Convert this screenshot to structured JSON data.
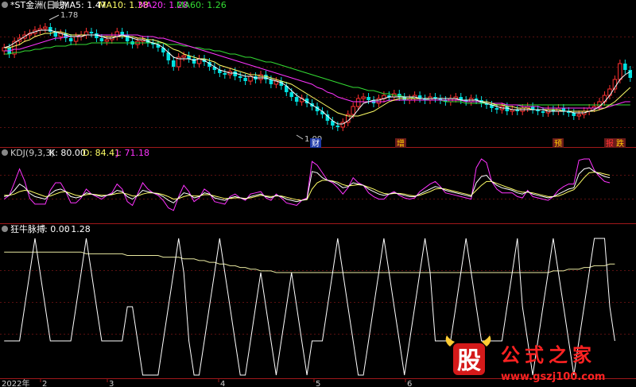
{
  "top_panel": {
    "title": "*ST金洲(日线)",
    "indicators": [
      {
        "label": "MA5: 1.47",
        "color": "#ffffff"
      },
      {
        "label": "MA10: 1.38",
        "color": "#ffff66"
      },
      {
        "label": "MA20: 1.28",
        "color": "#ff33ff"
      },
      {
        "label": "MA60: 1.26",
        "color": "#33dd33"
      }
    ],
    "high_label": "1.78",
    "low_label": "1.09",
    "markers": [
      {
        "text": "财",
        "color": "#3a6bff"
      },
      {
        "text": "增",
        "color": "#ffcc00"
      },
      {
        "text": "预",
        "color": "#ffcc00"
      },
      {
        "text": "报",
        "color": "#ff3333"
      },
      {
        "text": "跌",
        "color": "#ffcc00"
      }
    ]
  },
  "kdj_panel": {
    "title": "KDJ(9,3,3)",
    "values": [
      {
        "label": "K: 80.00",
        "color": "#ffffff"
      },
      {
        "label": "D: 84.41",
        "color": "#ffff66"
      },
      {
        "label": "J: 71.18",
        "color": "#ff33ff"
      }
    ]
  },
  "bottom_panel": {
    "title": "狂牛脉搏",
    "values": [
      {
        "label": ": 0.00",
        "color": "#ffffff"
      },
      {
        "label": ": 1.28",
        "color": "#ffffff"
      }
    ]
  },
  "x_axis": {
    "labels": [
      "2022年",
      "2",
      "3",
      "4",
      "5",
      "6"
    ]
  },
  "watermark": {
    "logo_char": "股",
    "name": "公式之家",
    "url": "www.gszj100.com"
  },
  "chart_data": {
    "type": "candlestick",
    "price": {
      "ylim": [
        1.0,
        1.85
      ],
      "closes": [
        1.62,
        1.58,
        1.66,
        1.68,
        1.7,
        1.71,
        1.73,
        1.74,
        1.75,
        1.72,
        1.69,
        1.71,
        1.68,
        1.66,
        1.69,
        1.7,
        1.72,
        1.71,
        1.68,
        1.66,
        1.67,
        1.69,
        1.72,
        1.7,
        1.66,
        1.64,
        1.66,
        1.67,
        1.65,
        1.64,
        1.62,
        1.59,
        1.54,
        1.5,
        1.56,
        1.57,
        1.55,
        1.52,
        1.55,
        1.53,
        1.5,
        1.48,
        1.46,
        1.45,
        1.47,
        1.44,
        1.43,
        1.41,
        1.44,
        1.42,
        1.45,
        1.42,
        1.39,
        1.41,
        1.38,
        1.34,
        1.31,
        1.28,
        1.3,
        1.27,
        1.25,
        1.22,
        1.2,
        1.16,
        1.13,
        1.12,
        1.15,
        1.2,
        1.25,
        1.3,
        1.31,
        1.29,
        1.27,
        1.3,
        1.32,
        1.31,
        1.33,
        1.31,
        1.29,
        1.3,
        1.32,
        1.3,
        1.29,
        1.31,
        1.3,
        1.29,
        1.28,
        1.3,
        1.31,
        1.29,
        1.28,
        1.3,
        1.29,
        1.27,
        1.26,
        1.24,
        1.23,
        1.25,
        1.22,
        1.23,
        1.22,
        1.24,
        1.25,
        1.23,
        1.22,
        1.21,
        1.23,
        1.22,
        1.24,
        1.22,
        1.21,
        1.19,
        1.2,
        1.22,
        1.24,
        1.25,
        1.28,
        1.32,
        1.36,
        1.42,
        1.52,
        1.48,
        1.43
      ],
      "ma5": [
        1.62,
        1.63,
        1.65,
        1.67,
        1.69,
        1.71,
        1.72,
        1.73,
        1.73,
        1.73,
        1.72,
        1.71,
        1.7,
        1.69,
        1.69,
        1.69,
        1.7,
        1.7,
        1.7,
        1.69,
        1.68,
        1.68,
        1.69,
        1.7,
        1.69,
        1.68,
        1.67,
        1.67,
        1.66,
        1.65,
        1.64,
        1.62,
        1.59,
        1.56,
        1.55,
        1.55,
        1.55,
        1.54,
        1.55,
        1.54,
        1.52,
        1.5,
        1.48,
        1.47,
        1.46,
        1.46,
        1.45,
        1.44,
        1.44,
        1.43,
        1.43,
        1.43,
        1.42,
        1.41,
        1.4,
        1.38,
        1.35,
        1.32,
        1.3,
        1.28,
        1.26,
        1.24,
        1.22,
        1.19,
        1.16,
        1.14,
        1.14,
        1.16,
        1.19,
        1.23,
        1.27,
        1.28,
        1.29,
        1.29,
        1.3,
        1.31,
        1.31,
        1.31,
        1.31,
        1.31,
        1.31,
        1.3,
        1.3,
        1.3,
        1.3,
        1.3,
        1.3,
        1.3,
        1.3,
        1.29,
        1.29,
        1.29,
        1.29,
        1.28,
        1.27,
        1.26,
        1.25,
        1.24,
        1.24,
        1.23,
        1.23,
        1.23,
        1.23,
        1.23,
        1.23,
        1.23,
        1.22,
        1.22,
        1.22,
        1.22,
        1.22,
        1.21,
        1.21,
        1.21,
        1.22,
        1.23,
        1.25,
        1.28,
        1.32,
        1.37,
        1.42,
        1.45,
        1.47
      ],
      "ma10": [
        1.62,
        1.62,
        1.63,
        1.64,
        1.66,
        1.67,
        1.69,
        1.7,
        1.71,
        1.71,
        1.72,
        1.72,
        1.71,
        1.7,
        1.7,
        1.7,
        1.7,
        1.7,
        1.7,
        1.69,
        1.69,
        1.69,
        1.69,
        1.69,
        1.69,
        1.69,
        1.68,
        1.68,
        1.67,
        1.67,
        1.66,
        1.65,
        1.63,
        1.61,
        1.6,
        1.58,
        1.57,
        1.56,
        1.55,
        1.55,
        1.54,
        1.53,
        1.51,
        1.5,
        1.49,
        1.48,
        1.47,
        1.46,
        1.45,
        1.45,
        1.44,
        1.44,
        1.43,
        1.42,
        1.41,
        1.4,
        1.39,
        1.37,
        1.35,
        1.33,
        1.31,
        1.29,
        1.27,
        1.25,
        1.23,
        1.21,
        1.2,
        1.19,
        1.19,
        1.19,
        1.2,
        1.21,
        1.22,
        1.24,
        1.26,
        1.28,
        1.29,
        1.3,
        1.3,
        1.3,
        1.3,
        1.3,
        1.3,
        1.3,
        1.3,
        1.3,
        1.3,
        1.3,
        1.3,
        1.29,
        1.29,
        1.29,
        1.29,
        1.28,
        1.28,
        1.27,
        1.26,
        1.26,
        1.25,
        1.25,
        1.24,
        1.24,
        1.24,
        1.23,
        1.23,
        1.23,
        1.23,
        1.23,
        1.23,
        1.22,
        1.22,
        1.22,
        1.22,
        1.22,
        1.22,
        1.22,
        1.23,
        1.24,
        1.26,
        1.28,
        1.31,
        1.34,
        1.37
      ],
      "ma20": [
        1.6,
        1.6,
        1.61,
        1.61,
        1.62,
        1.63,
        1.64,
        1.65,
        1.66,
        1.67,
        1.68,
        1.68,
        1.69,
        1.69,
        1.69,
        1.7,
        1.7,
        1.7,
        1.7,
        1.7,
        1.7,
        1.7,
        1.7,
        1.7,
        1.7,
        1.7,
        1.7,
        1.69,
        1.69,
        1.69,
        1.68,
        1.68,
        1.67,
        1.66,
        1.65,
        1.64,
        1.63,
        1.62,
        1.61,
        1.6,
        1.59,
        1.58,
        1.57,
        1.56,
        1.55,
        1.54,
        1.53,
        1.52,
        1.51,
        1.5,
        1.49,
        1.48,
        1.47,
        1.46,
        1.45,
        1.44,
        1.43,
        1.42,
        1.41,
        1.4,
        1.39,
        1.37,
        1.36,
        1.34,
        1.33,
        1.31,
        1.3,
        1.29,
        1.28,
        1.28,
        1.28,
        1.28,
        1.28,
        1.28,
        1.28,
        1.29,
        1.29,
        1.29,
        1.29,
        1.29,
        1.29,
        1.29,
        1.29,
        1.29,
        1.29,
        1.29,
        1.29,
        1.29,
        1.29,
        1.29,
        1.28,
        1.28,
        1.28,
        1.28,
        1.28,
        1.27,
        1.27,
        1.27,
        1.26,
        1.26,
        1.26,
        1.25,
        1.25,
        1.25,
        1.25,
        1.24,
        1.24,
        1.24,
        1.24,
        1.24,
        1.24,
        1.24,
        1.24,
        1.24,
        1.24,
        1.24,
        1.24,
        1.24,
        1.25,
        1.26,
        1.27,
        1.28,
        1.28
      ],
      "ma60": [
        1.58,
        1.58,
        1.59,
        1.59,
        1.6,
        1.6,
        1.61,
        1.61,
        1.62,
        1.62,
        1.63,
        1.63,
        1.63,
        1.64,
        1.64,
        1.64,
        1.64,
        1.65,
        1.65,
        1.65,
        1.65,
        1.65,
        1.65,
        1.65,
        1.65,
        1.65,
        1.65,
        1.65,
        1.65,
        1.65,
        1.65,
        1.65,
        1.64,
        1.64,
        1.64,
        1.63,
        1.63,
        1.62,
        1.62,
        1.61,
        1.61,
        1.6,
        1.6,
        1.59,
        1.58,
        1.58,
        1.57,
        1.56,
        1.56,
        1.55,
        1.54,
        1.53,
        1.53,
        1.52,
        1.51,
        1.5,
        1.49,
        1.48,
        1.47,
        1.46,
        1.45,
        1.44,
        1.43,
        1.42,
        1.41,
        1.4,
        1.39,
        1.38,
        1.37,
        1.37,
        1.36,
        1.35,
        1.35,
        1.34,
        1.33,
        1.33,
        1.32,
        1.32,
        1.31,
        1.31,
        1.3,
        1.3,
        1.3,
        1.29,
        1.29,
        1.29,
        1.28,
        1.28,
        1.28,
        1.28,
        1.27,
        1.27,
        1.27,
        1.27,
        1.27,
        1.26,
        1.26,
        1.26,
        1.26,
        1.26,
        1.26,
        1.26,
        1.26,
        1.26,
        1.26,
        1.26,
        1.26,
        1.26,
        1.26,
        1.26,
        1.26,
        1.26,
        1.26,
        1.26,
        1.26,
        1.26,
        1.26,
        1.26,
        1.26,
        1.26,
        1.26,
        1.26,
        1.26
      ]
    },
    "kdj": {
      "ylim": [
        0,
        100
      ],
      "k": [
        40,
        42,
        50,
        60,
        55,
        45,
        40,
        38,
        36,
        44,
        50,
        52,
        48,
        40,
        38,
        40,
        46,
        44,
        42,
        40,
        42,
        44,
        50,
        48,
        40,
        36,
        42,
        50,
        48,
        46,
        44,
        40,
        34,
        30,
        38,
        46,
        44,
        38,
        40,
        46,
        44,
        38,
        36,
        34,
        38,
        40,
        38,
        36,
        40,
        42,
        44,
        40,
        38,
        42,
        40,
        36,
        34,
        32,
        34,
        36,
        80,
        78,
        70,
        66,
        64,
        60,
        54,
        56,
        62,
        60,
        58,
        52,
        48,
        44,
        42,
        44,
        46,
        44,
        42,
        40,
        40,
        44,
        48,
        52,
        56,
        54,
        50,
        48,
        46,
        44,
        42,
        40,
        62,
        72,
        74,
        64,
        58,
        54,
        52,
        50,
        46,
        44,
        48,
        44,
        42,
        40,
        38,
        40,
        44,
        48,
        52,
        54,
        76,
        84,
        86,
        80,
        76,
        72,
        70
      ],
      "d": [
        42,
        42,
        44,
        48,
        50,
        49,
        46,
        43,
        40,
        41,
        44,
        47,
        48,
        45,
        42,
        41,
        43,
        44,
        43,
        42,
        42,
        43,
        45,
        46,
        44,
        41,
        41,
        44,
        46,
        46,
        45,
        43,
        40,
        36,
        37,
        40,
        42,
        41,
        41,
        43,
        43,
        41,
        39,
        37,
        37,
        38,
        38,
        37,
        38,
        40,
        42,
        41,
        40,
        41,
        41,
        39,
        37,
        35,
        34,
        35,
        52,
        62,
        66,
        66,
        65,
        63,
        59,
        57,
        58,
        59,
        58,
        55,
        52,
        48,
        45,
        44,
        45,
        45,
        44,
        42,
        41,
        42,
        45,
        48,
        52,
        53,
        52,
        50,
        48,
        46,
        44,
        42,
        50,
        58,
        64,
        64,
        61,
        58,
        55,
        52,
        49,
        47,
        47,
        46,
        44,
        42,
        40,
        40,
        41,
        44,
        48,
        51,
        60,
        70,
        78,
        79,
        78,
        76,
        74
      ],
      "j": [
        36,
        42,
        62,
        84,
        65,
        37,
        28,
        28,
        28,
        50,
        62,
        62,
        48,
        30,
        30,
        38,
        52,
        44,
        40,
        36,
        42,
        46,
        60,
        52,
        32,
        26,
        44,
        62,
        52,
        46,
        42,
        34,
        22,
        18,
        40,
        58,
        48,
        32,
        38,
        52,
        46,
        32,
        30,
        28,
        40,
        44,
        38,
        34,
        44,
        46,
        48,
        38,
        34,
        44,
        38,
        30,
        28,
        26,
        34,
        38,
        96,
        90,
        78,
        66,
        62,
        54,
        44,
        54,
        70,
        62,
        58,
        46,
        40,
        36,
        36,
        44,
        48,
        42,
        38,
        36,
        38,
        48,
        54,
        60,
        64,
        56,
        46,
        44,
        42,
        40,
        38,
        36,
        86,
        100,
        94,
        64,
        52,
        46,
        46,
        46,
        40,
        38,
        50,
        40,
        38,
        36,
        34,
        40,
        50,
        56,
        60,
        60,
        98,
        100,
        100,
        82,
        72,
        64,
        62
      ]
    },
    "bull_pulse": {
      "ylim": [
        0,
        4
      ],
      "signal": [
        1,
        1,
        1,
        1,
        2,
        3,
        4,
        3,
        2,
        1,
        1,
        1,
        1,
        1,
        2,
        3,
        4,
        3,
        2,
        1,
        1,
        1,
        1,
        1,
        2,
        2,
        1,
        0,
        0,
        0,
        0,
        1,
        2,
        3,
        4,
        3,
        1,
        0,
        0,
        1,
        2,
        3,
        4,
        3,
        2,
        1,
        0,
        0,
        1,
        2,
        3,
        2,
        1,
        0,
        1,
        2,
        3,
        2,
        1,
        0,
        1,
        1,
        1,
        2,
        3,
        4,
        3,
        2,
        1,
        0,
        0,
        1,
        2,
        3,
        4,
        3,
        2,
        1,
        0,
        1,
        2,
        3,
        4,
        3,
        1,
        1,
        1,
        1,
        2,
        3,
        4,
        3,
        2,
        1,
        1,
        1,
        1,
        1,
        2,
        3,
        4,
        2,
        1,
        0,
        1,
        2,
        3,
        4,
        3,
        2,
        1,
        0,
        1,
        2,
        3,
        4,
        4,
        4,
        2,
        1
      ],
      "trend": [
        3.6,
        3.6,
        3.6,
        3.6,
        3.6,
        3.6,
        3.6,
        3.6,
        3.6,
        3.6,
        3.6,
        3.6,
        3.6,
        3.6,
        3.6,
        3.6,
        3.55,
        3.55,
        3.55,
        3.55,
        3.55,
        3.55,
        3.55,
        3.55,
        3.5,
        3.5,
        3.5,
        3.5,
        3.5,
        3.5,
        3.5,
        3.45,
        3.45,
        3.45,
        3.45,
        3.4,
        3.4,
        3.4,
        3.35,
        3.35,
        3.3,
        3.3,
        3.25,
        3.25,
        3.2,
        3.2,
        3.15,
        3.15,
        3.1,
        3.1,
        3.05,
        3.05,
        3.05,
        3.0,
        3.0,
        3.0,
        3.0,
        3.0,
        3.0,
        3.0,
        3.0,
        3.0,
        3.0,
        3.0,
        3.0,
        3.0,
        3.0,
        3.0,
        3.0,
        3.0,
        3.0,
        3.0,
        3.0,
        3.0,
        3.0,
        3.0,
        3.0,
        3.0,
        3.0,
        3.0,
        3.0,
        3.0,
        3.0,
        3.0,
        3.0,
        3.0,
        3.0,
        3.0,
        3.0,
        3.0,
        3.0,
        3.0,
        3.0,
        3.0,
        3.0,
        3.0,
        3.0,
        3.0,
        3.0,
        3.0,
        3.0,
        3.0,
        3.0,
        3.0,
        3.0,
        3.0,
        3.0,
        3.05,
        3.05,
        3.05,
        3.1,
        3.1,
        3.1,
        3.15,
        3.15,
        3.2,
        3.2,
        3.2,
        3.25,
        3.25
      ]
    }
  }
}
